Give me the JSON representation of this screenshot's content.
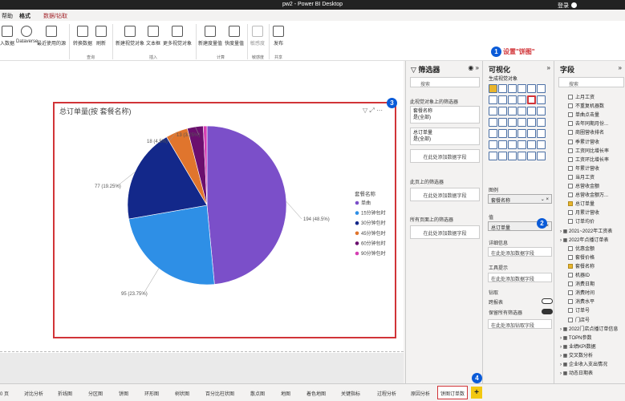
{
  "window": {
    "title": "pw2 - Power BI Desktop",
    "login": "登录"
  },
  "ribbon_tabs": [
    {
      "label": "帮助",
      "state": "normal"
    },
    {
      "label": "格式",
      "state": "active"
    },
    {
      "label": "数据/钻取",
      "state": "red"
    }
  ],
  "ribbon": {
    "buttons": [
      "入数据",
      "Dataverse",
      "最近使用的源",
      "转换数据",
      "刷新",
      "新建视觉对象",
      "文本框",
      "更多视觉对象",
      "新建度量值",
      "快度量值",
      "敏感度",
      "发布"
    ],
    "groups": [
      "查询",
      "插入",
      "计算",
      "敏感度",
      "共享"
    ]
  },
  "chart_data": {
    "type": "pie",
    "title": "总订单量(按 套餐名称)",
    "legend_title": "套餐名称",
    "legend_position": "right",
    "series": [
      {
        "name": "单曲",
        "value": 194,
        "pct": "48.5%",
        "color": "#7b4fc9",
        "label": "194 (48.5%)"
      },
      {
        "name": "15分钟包时",
        "value": 95,
        "pct": "23.75%",
        "color": "#2e8fe6",
        "label": "95 (23.75%)"
      },
      {
        "name": "30分钟包时",
        "value": 77,
        "pct": "19.25%",
        "color": "#13288a",
        "label": "77 (19.25%)"
      },
      {
        "name": "45分钟包时",
        "value": 18,
        "pct": "4.5%",
        "color": "#e0752d",
        "label": "18 (4.5%)"
      },
      {
        "name": "60分钟包时",
        "value": 13,
        "pct": "3.25%",
        "color": "#6b0f6e",
        "label": "13 (3.25%)"
      },
      {
        "name": "90分钟包时",
        "value": 3,
        "pct": "0.75%",
        "color": "#d63fb3",
        "label": ""
      }
    ]
  },
  "page_tabs": [
    "0 页",
    "对比分析",
    "折线图",
    "分区图",
    "饼图",
    "环形图",
    "树状图",
    "百分比柱状图",
    "散点图",
    "地图",
    "着色地图",
    "关键指标",
    "过程分析",
    "原因分析",
    "饼图订单数"
  ],
  "filter_pane": {
    "title": "筛选器",
    "search": "搜索",
    "section_visual": "此视觉对象上的筛选器",
    "card1_name": "套餐名称",
    "card1_value": "是(全部)",
    "card2_name": "总订单量",
    "card2_value": "是(全部)",
    "add_field": "在此处添加数据字段",
    "section_page": "此页上的筛选器",
    "section_all": "所有页面上的筛选器"
  },
  "viz_pane": {
    "title": "可视化",
    "subtitle": "生成视觉对象",
    "legend_label": "图例",
    "legend_field": "套餐名称",
    "values_label": "值",
    "values_field": "总订单量",
    "details_label": "详细信息",
    "add_field": "在此处添加数据字段",
    "tooltip_label": "工具提示",
    "drill_label": "钻取",
    "cross_report": "跨报表",
    "keep_filters": "保留所有筛选器",
    "drill_add": "在此处添加钻取字段",
    "annotation": "设置\"饼图\""
  },
  "fields_pane": {
    "title": "字段",
    "search": "搜索",
    "items": [
      {
        "label": "上月工资",
        "check": false,
        "indent": 2
      },
      {
        "label": "不重复机器数",
        "check": false,
        "indent": 2
      },
      {
        "label": "单曲点击量",
        "check": false,
        "indent": 2
      },
      {
        "label": "去年同期月份...",
        "check": false,
        "indent": 2
      },
      {
        "label": "商圈营收排名",
        "check": false,
        "indent": 2
      },
      {
        "label": "季累计营收",
        "check": false,
        "indent": 2
      },
      {
        "label": "工资同比增长率",
        "check": false,
        "indent": 2
      },
      {
        "label": "工资环比增长率",
        "check": false,
        "indent": 2
      },
      {
        "label": "年累计营收",
        "check": false,
        "indent": 2
      },
      {
        "label": "当月工资",
        "check": false,
        "indent": 2
      },
      {
        "label": "总营收金额",
        "check": false,
        "indent": 2
      },
      {
        "label": "总营收金额万...",
        "check": false,
        "indent": 2
      },
      {
        "label": "总订单量",
        "check": true,
        "indent": 2
      },
      {
        "label": "月累计营收",
        "check": false,
        "indent": 2
      },
      {
        "label": "订单均价",
        "check": false,
        "indent": 2
      },
      {
        "label": "2021~2022年工资表",
        "check": null,
        "indent": 0
      },
      {
        "label": "2022年点播订单表",
        "check": null,
        "indent": 0
      },
      {
        "label": "优惠金额",
        "check": false,
        "indent": 2
      },
      {
        "label": "套餐价格",
        "check": false,
        "indent": 2
      },
      {
        "label": "套餐名称",
        "check": true,
        "indent": 2
      },
      {
        "label": "机器ID",
        "check": false,
        "indent": 2
      },
      {
        "label": "消费日期",
        "check": false,
        "indent": 2
      },
      {
        "label": "消费时间",
        "check": false,
        "indent": 2
      },
      {
        "label": "消费水平",
        "check": false,
        "indent": 2
      },
      {
        "label": "订单号",
        "check": false,
        "indent": 2
      },
      {
        "label": "门店号",
        "check": false,
        "indent": 2
      },
      {
        "label": "2022门店点播订单信息",
        "check": null,
        "indent": 0
      },
      {
        "label": "TOPN参数",
        "check": null,
        "indent": 0
      },
      {
        "label": "业绩KPI数据",
        "check": null,
        "indent": 0
      },
      {
        "label": "交叉数分析",
        "check": null,
        "indent": 0
      },
      {
        "label": "企业收入支出情况",
        "check": null,
        "indent": 0
      },
      {
        "label": "动态日期表",
        "check": null,
        "indent": 0
      }
    ]
  },
  "badges": [
    "1",
    "2",
    "3",
    "4"
  ]
}
